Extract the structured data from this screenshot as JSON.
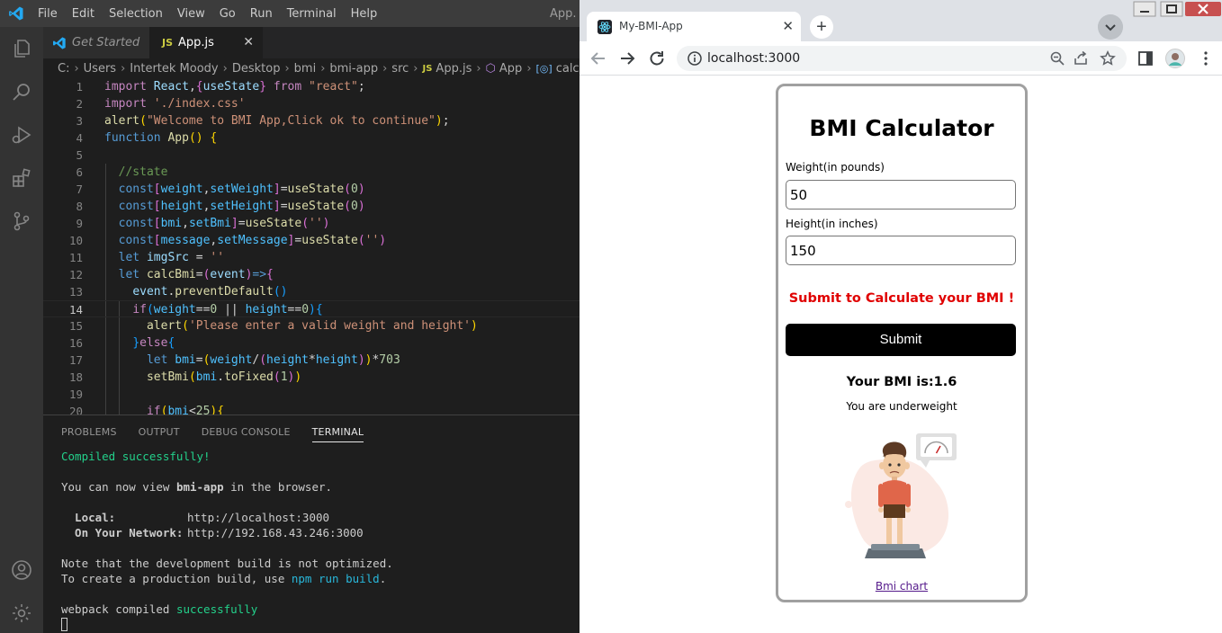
{
  "vscode": {
    "menu": [
      "File",
      "Edit",
      "Selection",
      "View",
      "Go",
      "Run",
      "Terminal",
      "Help"
    ],
    "window_title": "App.",
    "tabs": [
      {
        "label": "Get Started"
      },
      {
        "label": "App.js",
        "badge": "JS"
      }
    ],
    "breadcrumb": [
      "C:",
      "Users",
      "Intertek Moody",
      "Desktop",
      "bmi",
      "bmi-app",
      "src",
      "App.js",
      "App",
      "calcBmi"
    ],
    "line_numbers": [
      "1",
      "2",
      "3",
      "4",
      "5",
      "6",
      "7",
      "8",
      "9",
      "10",
      "11",
      "12",
      "13",
      "14",
      "15",
      "16",
      "17",
      "18",
      "19",
      "20"
    ],
    "current_line": "14",
    "panel_tabs": [
      "PROBLEMS",
      "OUTPUT",
      "DEBUG CONSOLE",
      "TERMINAL"
    ],
    "terminal": {
      "compiled": "Compiled successfully!",
      "view_prefix": "You can now view ",
      "app_name": "bmi-app",
      "view_suffix": " in the browser.",
      "local_label": "  Local:",
      "local_url": "http://localhost:3000",
      "network_label": "  On Your Network:",
      "network_url": "http://192.168.43.246:3000",
      "note1": "Note that the development build is not optimized.",
      "note2_prefix": "To create a production build, use ",
      "note2_cmd": "npm run build",
      "note2_suffix": ".",
      "webpack_prefix": "webpack compiled ",
      "webpack_status": "successfully"
    }
  },
  "chrome": {
    "tab_title": "My-BMI-App",
    "url": "localhost:3000"
  },
  "app": {
    "title": "BMI Calculator",
    "weight_label": "Weight(in pounds)",
    "weight_value": "50",
    "height_label": "Height(in inches)",
    "height_value": "150",
    "prompt": "Submit to Calculate your BMI !",
    "submit_label": "Submit",
    "result": "Your BMI is:1.6",
    "message": "You are underweight",
    "chart_link": "Bmi chart"
  },
  "colors": {
    "accent_error": "#e00000",
    "terminal_green": "#23d18b",
    "terminal_cyan": "#29b8db"
  }
}
